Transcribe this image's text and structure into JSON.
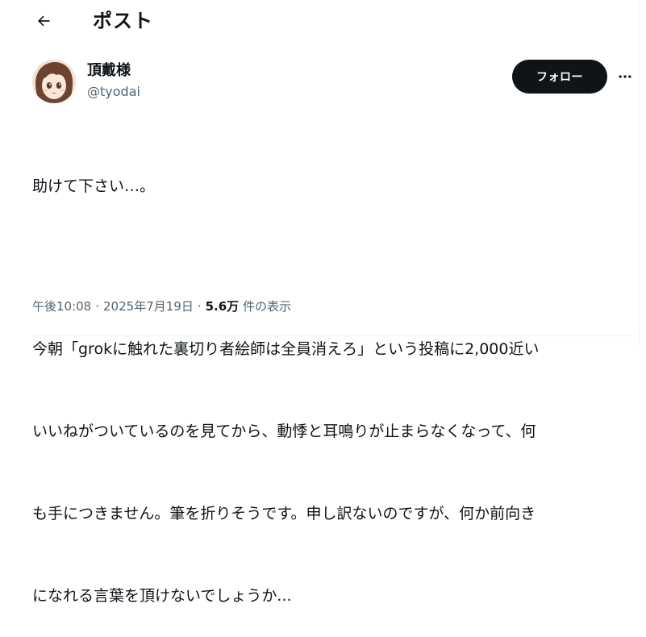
{
  "header": {
    "title": "ポスト",
    "back_icon": "arrow-left-icon"
  },
  "author": {
    "display_name": "頂戴様",
    "handle": "@tyodai",
    "follow_label": "フォロー",
    "more_icon": "more-horizontal-icon"
  },
  "post": {
    "lines": [
      "助けて下さい…。",
      "今朝「grokに触れた裏切り者絵師は全員消えろ」という投稿に2,000近い",
      "いいねがついているのを見てから、動悸と耳鳴りが止まらなくなって、何",
      "も手につきません。筆を折りそうです。申し訳ないのですが、何か前向き",
      "になれる言葉を頂けないでしょうか..."
    ]
  },
  "meta": {
    "time": "午後10:08",
    "date": "2025年7月19日",
    "separator": "·",
    "views_count": "5.6万",
    "views_label": "件の表示"
  },
  "colors": {
    "text": "#0f1419",
    "secondary": "#536471",
    "button_bg": "#0f1419",
    "button_text": "#ffffff",
    "divider": "#eff3f4"
  }
}
